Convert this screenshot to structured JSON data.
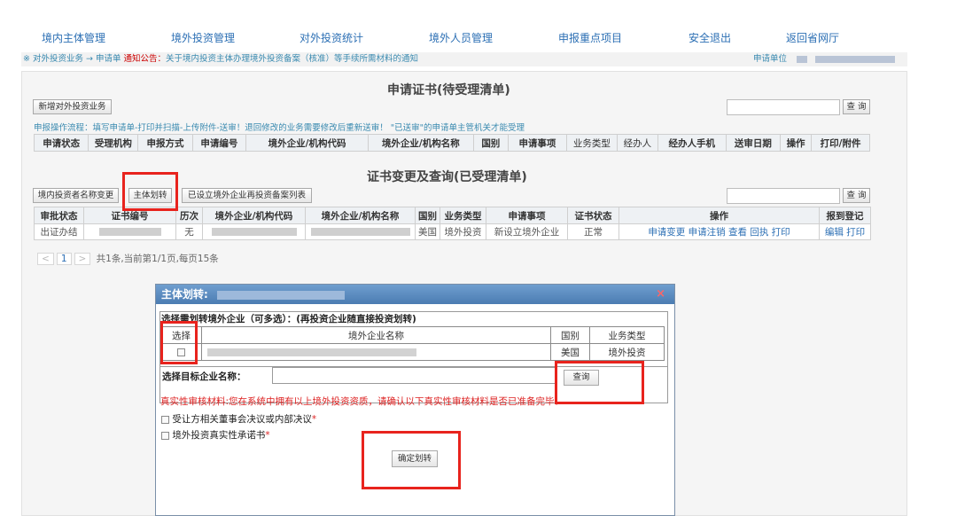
{
  "nav": {
    "items": [
      "境内主体管理",
      "境外投资管理",
      "对外投资统计",
      "境外人员管理",
      "申报重点项目",
      "安全退出",
      "返回省网厅"
    ]
  },
  "breadcrumb": {
    "path": "※ 对外投资业务 → 申请单",
    "notice_label": "通知公告：",
    "notice_text": "关于境内投资主体办理境外投资备案（核准）等手续所需材料的通知",
    "unit_label": "申请单位"
  },
  "pending": {
    "title": "申请证书(待受理清单)",
    "add_button": "新增对外投资业务",
    "search_button": "查 询",
    "flow_text": "申报操作流程：填写申请单-打印并扫描-上传附件-送审！退回修改的业务需要修改后重新送审！ \"已送审\"的申请单主管机关才能受理",
    "columns": [
      "申请状态",
      "受理机构",
      "申报方式",
      "申请编号",
      "境外企业/机构代码",
      "境外企业/机构名称",
      "国别",
      "申请事项",
      "业务类型",
      "经办人",
      "经办人手机",
      "送审日期",
      "操作",
      "打印/附件"
    ]
  },
  "accepted": {
    "title": "证书变更及查询(已受理清单)",
    "buttons": [
      "境内投资者名称变更",
      "主体划转",
      "已设立境外企业再投资备案列表"
    ],
    "search_button": "查 询",
    "columns": [
      "审批状态",
      "证书编号",
      "历次",
      "境外企业/机构代码",
      "境外企业/机构名称",
      "国别",
      "业务类型",
      "申请事项",
      "证书状态",
      "操作",
      "报到登记"
    ],
    "rows": [
      {
        "status": "出证办结",
        "times": "无",
        "country": "美国",
        "biz_type": "境外投资",
        "matter": "新设立境外企业",
        "cert_status": "正常",
        "ops": "申请变更  申请注销  查看  回执  打印",
        "register": "编辑  打印"
      }
    ],
    "pager": {
      "prev": "<",
      "page": "1",
      "next": ">",
      "summary": "共1条,当前第1/1页,每页15条"
    }
  },
  "dialog": {
    "title": "主体划转:",
    "close": "×",
    "subtitle": "选择需划转境外企业（可多选）：(再投资企业随直接投资划转)",
    "columns": [
      "选择",
      "境外企业名称",
      "国别",
      "业务类型"
    ],
    "rows": [
      {
        "country": "美国",
        "biz_type": "境外投资"
      }
    ],
    "target_label": "选择目标企业名称：",
    "query_button": "查询",
    "warning": "真实性审核材料:您在系统中拥有以上境外投资资质，请确认以下真实性审核材料是否已准备完毕：",
    "checks": [
      "受让方相关董事会决议或内部决议",
      "境外投资真实性承诺书"
    ],
    "confirm_button": "确定划转"
  },
  "colors": {
    "highlight": "#e8231d",
    "link": "#2c6fb4",
    "title_bar": "#5a8cc2"
  }
}
